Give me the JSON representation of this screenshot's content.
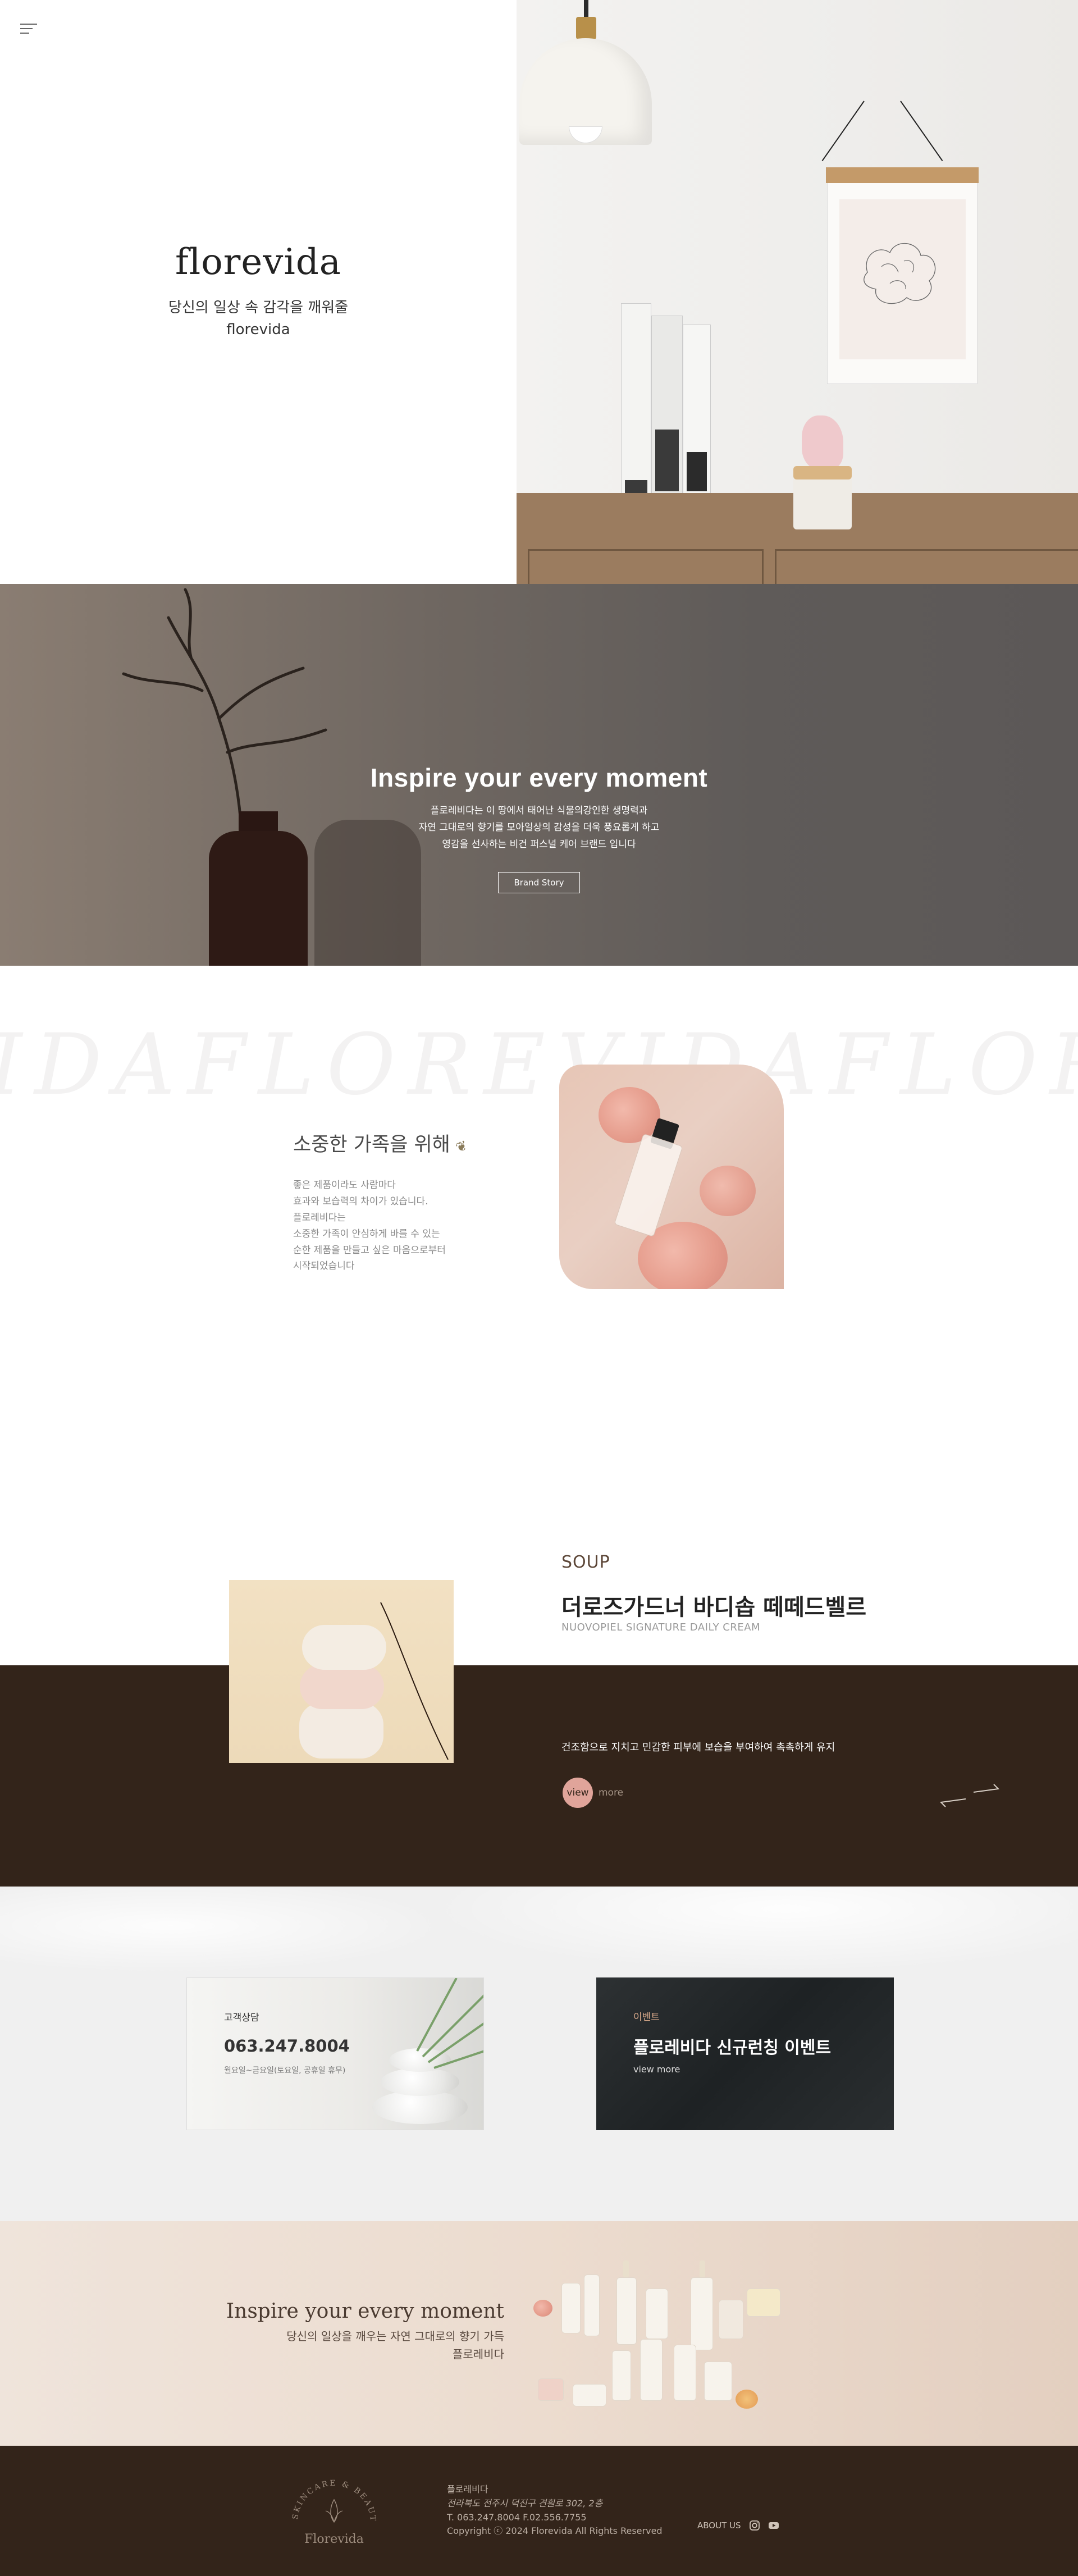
{
  "hero": {
    "logo": "florevida",
    "tagline": "당신의 일상 속 감각을 깨워줄",
    "tagline_brand": "florevida",
    "menu_icon": "hamburger-menu-icon"
  },
  "inspire": {
    "title": "Inspire your every moment",
    "lines": [
      "플로레비다는 이 땅에서 태어난 식물의강인한 생명력과",
      "자연 그대로의 향기를 모아일상의 감성을 더욱 풍요롭게 하고",
      "영감을 선사하는 비건 퍼스널 케어 브랜드 입니다"
    ],
    "button": "Brand Story"
  },
  "family": {
    "watermark": "IDAFLOREVIDAFLOREV",
    "title": "소중한 가족을 위해",
    "leaf_icon": "leaf-icon",
    "lines": [
      "좋은 제품이라도 사람마다",
      "효과와 보습력의 차이가 있습니다.",
      "플로레비다는",
      "소중한 가족이 안심하게 바를 수 있는",
      "순한 제품을 만들고 싶은 마음으로부터",
      "시작되었습니다"
    ]
  },
  "soup": {
    "category": "SOUP",
    "title": "더로즈가드너 바디솝 떼떼드벨르",
    "subtitle": "NUOVOPIEL SIGNATURE DAILY CREAM",
    "description": "건조함으로 지치고 민감한 피부에 보습을 부여하여 촉촉하게 유지",
    "view_label": "view",
    "more_label": "more",
    "prev_icon": "arrow-prev-icon",
    "next_icon": "arrow-next-icon"
  },
  "contact": {
    "cs_label": "고객상담",
    "cs_phone": "063.247.8004",
    "cs_hours": "월요일~금요일(토요일, 공휴일 휴무)",
    "event_label": "이벤트",
    "event_title": "플로레비다 신규런칭 이벤트",
    "event_more": "view more"
  },
  "banner": {
    "title": "Inspire your every moment",
    "sub1": "당신의 일상을 깨우는 자연 그대로의 향기 가득",
    "sub2": "플로레비다"
  },
  "footer": {
    "logo_arc": "SKINCARE & BEAUTY",
    "logo_name": "Florevida",
    "company": "플로레비다",
    "address": "전라북도 전주시 덕진구 견훤로 302, 2층",
    "phone": "T. 063.247.8004 F.02.556.7755",
    "copyright": "Copyright ⓒ 2024 Florevida All Rights Reserved",
    "nav_about": "ABOUT US",
    "instagram_icon": "instagram-icon",
    "youtube_icon": "youtube-icon"
  },
  "colors": {
    "dark_brown": "#33241a",
    "accent_pink": "#e0a49a",
    "inspire_bg": "#625e5c",
    "contact_bg": "#f0f0f0"
  }
}
